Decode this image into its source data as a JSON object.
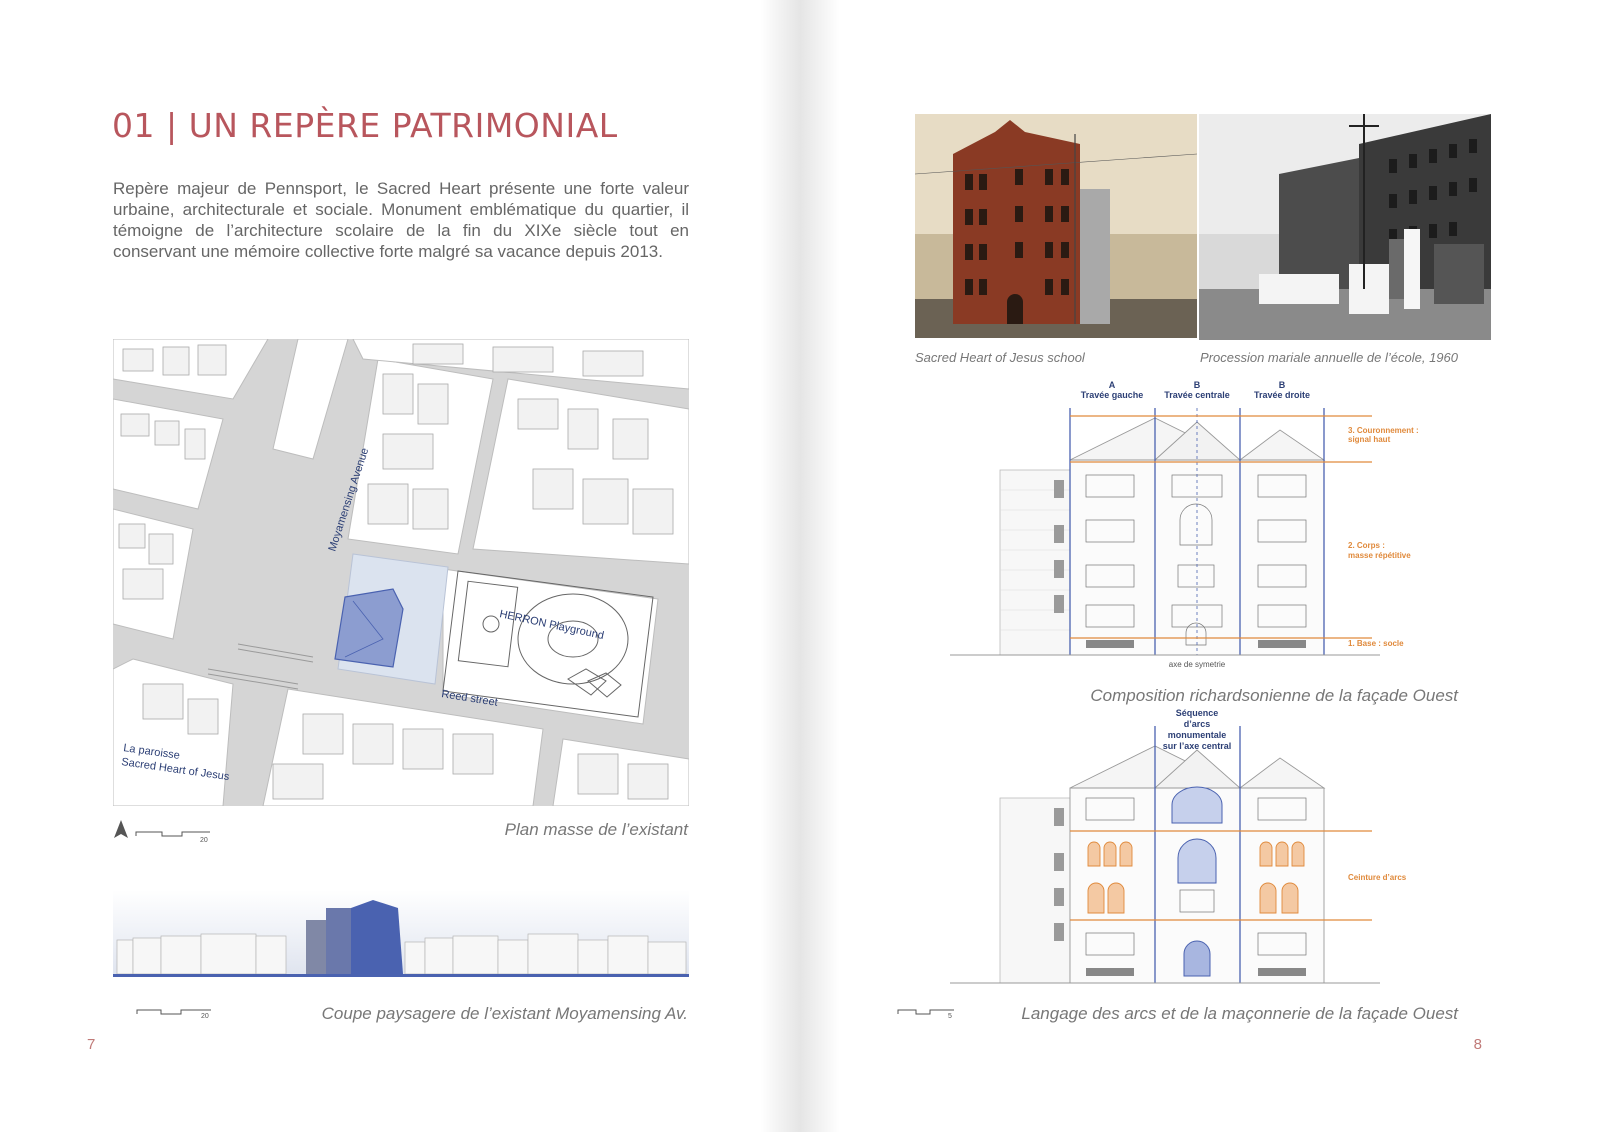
{
  "left_page": {
    "title": "01 | UN REPÈRE PATRIMONIAL",
    "intro": "Repère majeur de Pennsport, le Sacred Heart présente une forte valeur urbaine, architecturale et sociale. Monument emblématique du quartier, il témoigne de l’architecture scolaire de la fin du XIXe siècle tout en conservant une mémoire collective forte malgré sa vacance depuis 2013.",
    "map": {
      "street_avenue": "Moyamensing Avenue",
      "street_reed": "Reed street",
      "playground": "HERRON Playground",
      "parish_line1": "La paroisse",
      "parish_line2": "Sacred Heart of Jesus",
      "scale_label": "20"
    },
    "map_caption": "Plan masse de l’existant",
    "section_scale_label": "20",
    "section_caption": "Coupe paysagere de l’existant Moyamensing Av.",
    "page_number": "7"
  },
  "right_page": {
    "photo1_caption": "Sacred Heart of Jesus school",
    "photo2_caption": "Procession mariale annuelle de l’école, 1960",
    "elev1": {
      "bay_a_letter": "A",
      "bay_a_label": "Travée gauche",
      "bay_b_letter": "B",
      "bay_b_label": "Travée centrale",
      "bay_c_letter": "B",
      "bay_c_label": "Travée droite",
      "ann3_line1": "3. Couronnement :",
      "ann3_line2": "signal haut",
      "ann2_line1": "2. Corps :",
      "ann2_line2": "masse répétitive",
      "ann1": "1. Base : socle",
      "axis_label": "axe de symetrie",
      "caption": "Composition richardsonienne de la façade Ouest"
    },
    "elev2": {
      "seq_line1": "Séquence",
      "seq_line2": "d’arcs",
      "seq_line3": "monumentale",
      "seq_line4": "sur l’axe central",
      "arcs_label": "Ceinture d’arcs",
      "scale_label": "5",
      "caption": "Langage des arcs et de la maçonnerie de la façade Ouest"
    },
    "page_number": "8"
  },
  "colors": {
    "title": "#b8565d",
    "accent_blue": "#4a62b0",
    "accent_orange": "#e08a3c",
    "text": "#666666"
  }
}
